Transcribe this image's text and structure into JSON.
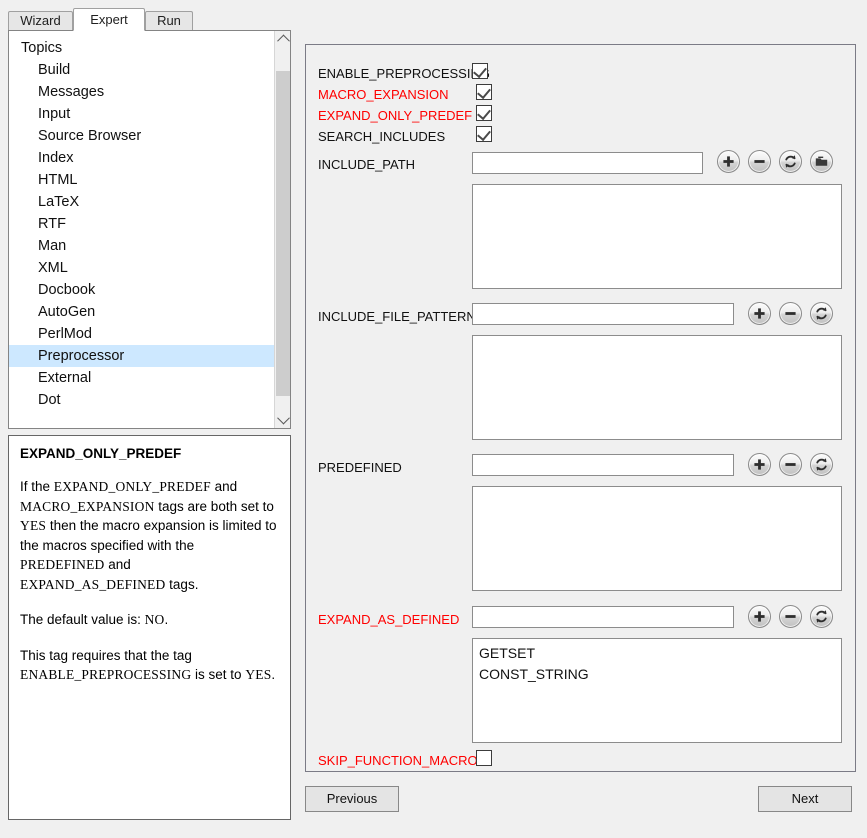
{
  "tabs": [
    {
      "id": "wizard",
      "label": "Wizard",
      "active": false
    },
    {
      "id": "expert",
      "label": "Expert",
      "active": true
    },
    {
      "id": "run",
      "label": "Run",
      "active": false
    }
  ],
  "sidebar": {
    "header": "Topics",
    "items": [
      {
        "label": "Build",
        "selected": false
      },
      {
        "label": "Messages",
        "selected": false
      },
      {
        "label": "Input",
        "selected": false
      },
      {
        "label": "Source Browser",
        "selected": false
      },
      {
        "label": "Index",
        "selected": false
      },
      {
        "label": "HTML",
        "selected": false
      },
      {
        "label": "LaTeX",
        "selected": false
      },
      {
        "label": "RTF",
        "selected": false
      },
      {
        "label": "Man",
        "selected": false
      },
      {
        "label": "XML",
        "selected": false
      },
      {
        "label": "Docbook",
        "selected": false
      },
      {
        "label": "AutoGen",
        "selected": false
      },
      {
        "label": "PerlMod",
        "selected": false
      },
      {
        "label": "Preprocessor",
        "selected": true
      },
      {
        "label": "External",
        "selected": false
      },
      {
        "label": "Dot",
        "selected": false
      }
    ],
    "scrollbar": {
      "up_icon": "chevron-up-icon",
      "down_icon": "chevron-down-icon"
    }
  },
  "help": {
    "title": "EXPAND_ONLY_PREDEF",
    "paragraph1_pre": "If the ",
    "paragraph1_tag1": "EXPAND_ONLY_PREDEF",
    "paragraph1_mid1": " and ",
    "paragraph1_tag2": "MACRO_EXPANSION",
    "paragraph1_mid2": " tags are both set to ",
    "paragraph1_yes": "YES",
    "paragraph1_mid3": " then the macro expansion is limited to the macros specified with the ",
    "paragraph1_tag3": "PREDEFINED",
    "paragraph1_mid4": " and ",
    "paragraph1_tag4": "EXPAND_AS_DEFINED",
    "paragraph1_end": " tags.",
    "paragraph2_pre": "The default value is: ",
    "paragraph2_value": "NO",
    "paragraph2_end": ".",
    "paragraph3_pre": "This tag requires that the tag ",
    "paragraph3_tag": "ENABLE_PREPROCESSING",
    "paragraph3_mid": " is set to ",
    "paragraph3_value": "YES",
    "paragraph3_end": "."
  },
  "colors": {
    "changed_tag": "#ff0000",
    "default_tag": "#111111",
    "selection": "#cde8ff"
  },
  "settings": {
    "checkboxes": [
      {
        "label": "ENABLE_PREPROCESSING",
        "checked": true,
        "changed": false
      },
      {
        "label": "MACRO_EXPANSION",
        "checked": true,
        "changed": true
      },
      {
        "label": "EXPAND_ONLY_PREDEF",
        "checked": true,
        "changed": true
      },
      {
        "label": "SEARCH_INCLUDES",
        "checked": true,
        "changed": false
      }
    ],
    "include_path": {
      "label": "INCLUDE_PATH",
      "value": "",
      "placeholder": "",
      "items": [],
      "buttons": [
        "add-icon",
        "remove-icon",
        "refresh-icon",
        "folder-icon"
      ],
      "changed": false
    },
    "include_file_patterns": {
      "label": "INCLUDE_FILE_PATTERNS",
      "value": "",
      "placeholder": "",
      "items": [],
      "buttons": [
        "add-icon",
        "remove-icon",
        "refresh-icon"
      ],
      "changed": false
    },
    "predefined": {
      "label": "PREDEFINED",
      "value": "",
      "placeholder": "",
      "items": [],
      "buttons": [
        "add-icon",
        "remove-icon",
        "refresh-icon"
      ],
      "changed": false
    },
    "expand_as_defined": {
      "label": "EXPAND_AS_DEFINED",
      "value": "",
      "placeholder": "",
      "items": [
        "GETSET",
        "CONST_STRING"
      ],
      "buttons": [
        "add-icon",
        "remove-icon",
        "refresh-icon"
      ],
      "changed": true
    },
    "skip_function_macros": {
      "label": "SKIP_FUNCTION_MACROS",
      "checked": false,
      "changed": true
    }
  },
  "footer": {
    "previous_label": "Previous",
    "next_label": "Next"
  }
}
